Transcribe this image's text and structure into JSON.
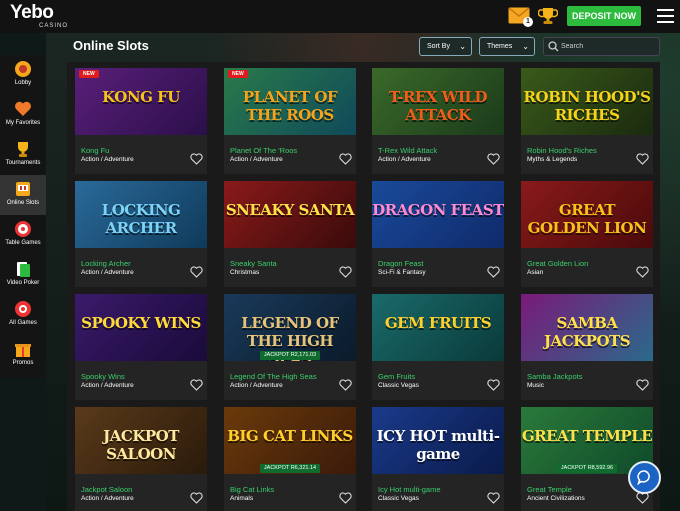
{
  "header": {
    "logo": "Yebo",
    "logo_sub": "CASINO",
    "mail_badge": "1",
    "deposit_label": "DEPOSIT NOW"
  },
  "sidebar": {
    "items": [
      {
        "label": "Lobby",
        "icon": "lobby-icon"
      },
      {
        "label": "My Favorites",
        "icon": "heart-icon"
      },
      {
        "label": "Tournaments",
        "icon": "trophy-icon"
      },
      {
        "label": "Online Slots",
        "icon": "slot-machine-icon",
        "active": true
      },
      {
        "label": "Table Games",
        "icon": "roulette-icon"
      },
      {
        "label": "Video Poker",
        "icon": "cards-icon"
      },
      {
        "label": "All Games",
        "icon": "chips-icon"
      },
      {
        "label": "Promos",
        "icon": "gift-icon"
      }
    ]
  },
  "main": {
    "title": "Online Slots",
    "sort_label": "Sort By",
    "themes_label": "Themes",
    "search_placeholder": "Search"
  },
  "games": [
    {
      "art": "KONG FU",
      "name": "Kong Fu",
      "category": "Action / Adventure",
      "badge": "NEW",
      "jackpot": null
    },
    {
      "art": "PLANET OF THE ROOS",
      "name": "Planet Of The 'Roos",
      "category": "Action / Adventure",
      "badge": "NEW",
      "jackpot": null
    },
    {
      "art": "T-REX WILD ATTACK",
      "name": "T-Rex Wild Attack",
      "category": "Action / Adventure",
      "badge": null,
      "jackpot": null
    },
    {
      "art": "ROBIN HOOD'S RICHES",
      "name": "Robin Hood's Riches",
      "category": "Myths & Legends",
      "badge": null,
      "jackpot": null
    },
    {
      "art": "LOCKING ARCHER",
      "name": "Locking Archer",
      "category": "Action / Adventure",
      "badge": null,
      "jackpot": null
    },
    {
      "art": "SNEAKY SANTA",
      "name": "Sneaky Santa",
      "category": "Christmas",
      "badge": null,
      "jackpot": null
    },
    {
      "art": "DRAGON FEAST",
      "name": "Dragon Feast",
      "category": "Sci-Fi & Fantasy",
      "badge": null,
      "jackpot": null
    },
    {
      "art": "GREAT GOLDEN LION",
      "name": "Great Golden Lion",
      "category": "Asian",
      "badge": null,
      "jackpot": null
    },
    {
      "art": "SPOOKY WINS",
      "name": "Spooky Wins",
      "category": "Action / Adventure",
      "badge": null,
      "jackpot": null
    },
    {
      "art": "LEGEND OF THE HIGH SEAS",
      "name": "Legend Of The High Seas",
      "category": "Action / Adventure",
      "badge": null,
      "jackpot": "JACKPOT R2,171.03"
    },
    {
      "art": "GEM FRUITS",
      "name": "Gem Fruits",
      "category": "Classic Vegas",
      "badge": null,
      "jackpot": null
    },
    {
      "art": "SAMBA JACKPOTS",
      "name": "Samba Jackpots",
      "category": "Music",
      "badge": null,
      "jackpot": null
    },
    {
      "art": "JACKPOT SALOON",
      "name": "Jackpot Saloon",
      "category": "Action / Adventure",
      "badge": null,
      "jackpot": null
    },
    {
      "art": "BIG CAT LINKS",
      "name": "Big Cat Links",
      "category": "Animals",
      "badge": null,
      "jackpot": "JACKPOT R6,321.14"
    },
    {
      "art": "ICY HOT multi-game",
      "name": "Icy Hot multi-game",
      "category": "Classic Vegas",
      "badge": null,
      "jackpot": null
    },
    {
      "art": "GREAT TEMPLE",
      "name": "Great Temple",
      "category": "Ancient Civilizations",
      "badge": null,
      "jackpot": "JACKPOT R8,592.96"
    }
  ],
  "colors": {
    "accent_green": "#2dbb3e",
    "game_name_green": "#3ad06b",
    "new_badge_red": "#e01b1b",
    "chat_blue": "#1c64c4"
  }
}
